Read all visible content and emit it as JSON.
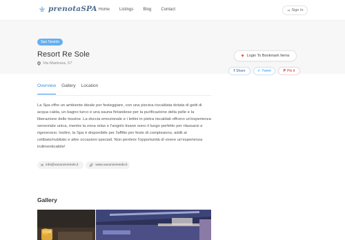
{
  "header": {
    "logo_text": "prenotaSPA",
    "nav": [
      "Home",
      "Listings",
      "Blog",
      "Contact"
    ],
    "signin_label": "Sign In"
  },
  "listing": {
    "tag": "Spa Taranto",
    "title": "Resort Re Sole",
    "address": "Via Marinara, 57",
    "bookmark_label": "Login To Bookmark Items",
    "share": {
      "facebook": "Share",
      "twitter": "Tweet",
      "pinterest": "Pin it"
    }
  },
  "tabs": [
    "Overview",
    "Gallery",
    "Location"
  ],
  "description": "La Spa offre un ambiente ideale per festeggiare, con una piscina riscaldata dotata di getti di acqua calda, un bagno turco e una sauna finlandese per la purificazione della pelle e la liberazione delle tossine. La doccia emozionale e i lettini in pietra riscaldati offrono un'esperienza sensoriale unica, mentre la zona relax e l'angolo tisane sono il luogo perfetto per rilassarsi e rigenerarsi. Inoltre, la Spa è disponibile per l'affitto per feste di compleanno, addii al celibato/nubilato e altre occasioni speciali. Non perdere l'opportunità di vivere un'esperienza indimenticabile!",
  "contacts": {
    "email": "info@vacanzeresole.it",
    "website": "www.vacanzeresole.it"
  },
  "gallery": {
    "title": "Gallery"
  },
  "colors": {
    "accent": "#3a8ee6",
    "tag_bg": "#64b0f0",
    "heart": "#e64545"
  }
}
